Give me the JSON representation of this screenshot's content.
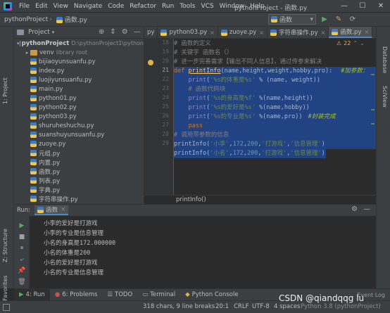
{
  "titlebar": {
    "menu": [
      "File",
      "Edit",
      "View",
      "Navigate",
      "Code",
      "Refactor",
      "Run",
      "Tools",
      "VCS",
      "Window",
      "Help"
    ],
    "title": "pythonProject - 函数.py",
    "controls": [
      "—",
      "☐",
      "✕"
    ]
  },
  "navbar": {
    "project": "pythonProject",
    "file": "函数.py",
    "run_config": "函数",
    "run_icons": [
      "▶",
      "✎",
      "⟳"
    ]
  },
  "left_strip": {
    "tabs": [
      "1: Project",
      "Z: Structure",
      "2: Favorites"
    ]
  },
  "right_strip": {
    "tabs": [
      "Database",
      "SciView"
    ]
  },
  "project_panel": {
    "header": "Project",
    "root_name": "pythonProject",
    "root_path": "D:\\pythonProject1\\python",
    "venv": "venv",
    "venv_note": "library root",
    "files": [
      "bijiaoyunsuanfu.py",
      "index.py",
      "luojiyunsuanfu.py",
      "main.py",
      "python01.py",
      "python02.py",
      "python03.py",
      "shuruheshuchu.py",
      "suanshuyunsuanfu.py",
      "zuoye.py",
      "元组.py",
      "内置.py",
      "函数.py",
      "列表.py",
      "字典.py",
      "字符串操作.py"
    ]
  },
  "editor_tabs": [
    "py",
    "python03.py",
    "zuoye.py",
    "字符串操作.py",
    "函数.py"
  ],
  "gutter": {
    "lines": [
      "18",
      "19",
      "20",
      "21",
      "22",
      "23",
      "24",
      "25",
      "26",
      "27",
      "28",
      "29"
    ]
  },
  "code": {
    "l18": "# 函数的定义",
    "l19": "# 关键字 函数名（）",
    "l20": "# 进一步完善需求【输出不同人信息】，通过传参来解决",
    "l21_kw": "def ",
    "l21_fn": "printInfo",
    "l21_rest": "(name,height,weight,hobby,pro):",
    "l21_cm": "#加参数：",
    "l22_fn": "print",
    "l22_str": "'%s的体重是%s'",
    "l22_rest": " % (name, weight))",
    "l23": "# 函数代码块",
    "l24_str": "'%s的身高是%f'",
    "l24_rest": " %(name,height))",
    "l25_str": "'%s的爱好是%s'",
    "l25_rest": " %(name,hobby))",
    "l26_str": "'%s的专业是%s'",
    "l26_rest": " %(name,pro))",
    "l26_cm": "#封装完成",
    "l27": "pass",
    "l28": "# 调用带参数的信息",
    "l29_a": "printInfo",
    "l29_str1": "'小李'",
    "l29_num1": "172",
    "l29_num2": "200",
    "l29_str2": "'打游戏'",
    "l29_str3": "'信息管理'",
    "l30_str1": "'小名'",
    "l30_num1": "172",
    "l30_num2": "200",
    "l30_str2": "'打游戏'",
    "l30_str3": "'信息管理'"
  },
  "inspection": {
    "count": "22"
  },
  "breadcrumb": "printInfo()",
  "run_panel": {
    "label": "Run:",
    "tab": "函数",
    "output": [
      "小李的爱好是打游戏",
      "小李的专业是信息管理",
      "小名的身高是172.000000",
      "小名的体重是200",
      "小名的爱好是打游戏",
      "小名的专业是信息管理"
    ]
  },
  "bottom_tabs": [
    "4: Run",
    "6: Problems",
    "TODO",
    "Terminal",
    "Python Console",
    "Event Log"
  ],
  "status": {
    "chars": "318 chars, 9 line breaks",
    "pos": "20:1",
    "eol": "CRLF",
    "enc": "UTF-8",
    "indent": "4 spaces",
    "interp": "Python 3.8 (pythonProject)"
  },
  "watermark": "CSDN @qiandqqg lu"
}
